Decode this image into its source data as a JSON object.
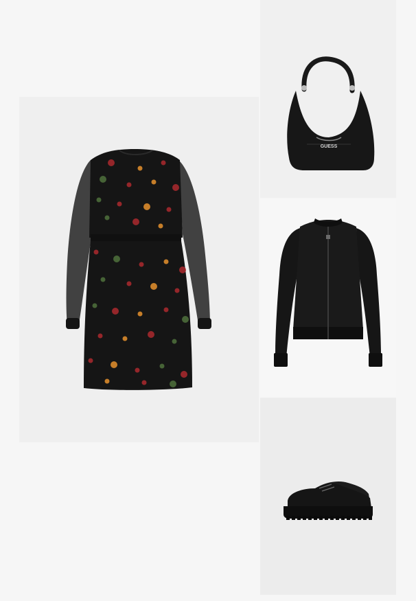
{
  "outfit": {
    "items": [
      {
        "id": "dress",
        "icon": "floral-dress-image"
      },
      {
        "id": "bag",
        "icon": "shoulder-bag-image",
        "logo_text": "GUESS"
      },
      {
        "id": "jacket",
        "icon": "bomber-jacket-image"
      },
      {
        "id": "shoes",
        "icon": "chunky-loafer-image"
      }
    ]
  },
  "colors": {
    "page_bg": "#f6f6f6",
    "tile_bg": "#efefef",
    "garment_black": "#151515",
    "flower_red": "#a3282c",
    "flower_orange": "#d98a2b",
    "leaf_green": "#4b6b3a"
  }
}
